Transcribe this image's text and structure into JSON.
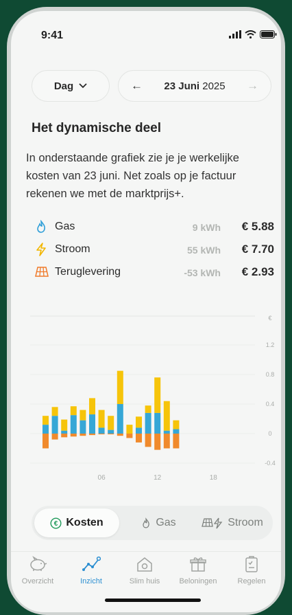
{
  "status": {
    "time": "9:41"
  },
  "period": {
    "selector_label": "Dag",
    "date_day": "23 Juni",
    "date_year": "2025"
  },
  "section": {
    "title": "Het dynamische deel",
    "intro": "In onderstaande grafiek zie je je werkelijke kosten van 23 juni. Net zoals op je factuur rekenen we met de marktprijs+."
  },
  "summary": [
    {
      "label": "Gas",
      "kwh": "9 kWh",
      "cost": "€ 5.88",
      "icon": "flame-icon",
      "color": "#2f9fd8"
    },
    {
      "label": "Stroom",
      "kwh": "55 kWh",
      "cost": "€ 7.70",
      "icon": "lightning-icon",
      "color": "#f2b600"
    },
    {
      "label": "Teruglevering",
      "kwh": "-53 kWh",
      "cost": "€ 2.93",
      "icon": "solar-panel-icon",
      "color": "#f07a2a"
    }
  ],
  "chart_data": {
    "type": "bar",
    "stacked": true,
    "unit_label": "€",
    "y_ticks": [
      "1.2",
      "0.8",
      "0.4",
      "0",
      "-0.4"
    ],
    "ylim": [
      -0.4,
      1.2
    ],
    "x_ticks": [
      "06",
      "12",
      "18"
    ],
    "x_tick_hours": [
      6,
      12,
      18
    ],
    "hours": [
      0,
      1,
      2,
      3,
      4,
      5,
      6,
      7,
      8,
      9,
      10,
      11,
      12,
      13,
      14,
      15,
      16,
      17,
      18,
      19,
      20,
      21,
      22,
      23
    ],
    "series": [
      {
        "name": "Gas",
        "color": "#36a7d6",
        "values": [
          0.12,
          0.24,
          0.04,
          0.25,
          0.18,
          0.26,
          0.08,
          0.05,
          0.4,
          0,
          0.08,
          0.28,
          0.28,
          0.04,
          0.06,
          0,
          0,
          0,
          0,
          0,
          0,
          0,
          0,
          0
        ]
      },
      {
        "name": "Stroom",
        "color": "#f6c40a",
        "values": [
          0.12,
          0.12,
          0.15,
          0.12,
          0.14,
          0.22,
          0.24,
          0.19,
          0.45,
          0.12,
          0.15,
          0.1,
          0.48,
          0.4,
          0.12,
          0,
          0,
          0,
          0,
          0,
          0,
          0,
          0,
          0
        ]
      },
      {
        "name": "Teruglevering",
        "color": "#f08a2c",
        "values": [
          -0.2,
          -0.08,
          -0.05,
          -0.04,
          -0.03,
          -0.02,
          -0.01,
          -0.01,
          -0.03,
          -0.06,
          -0.12,
          -0.18,
          -0.22,
          -0.2,
          -0.2,
          0,
          0,
          0,
          0,
          0,
          0,
          0,
          0,
          0
        ]
      }
    ]
  },
  "tabs_toggle": [
    {
      "label": "Kosten",
      "icon": "euro-icon",
      "active": true
    },
    {
      "label": "Gas",
      "icon": "flame-icon",
      "active": false
    },
    {
      "label": "Stroom",
      "icon": "solar-lightning-icon",
      "active": false
    }
  ],
  "nav": [
    {
      "label": "Overzicht",
      "icon": "piggy-bank-icon",
      "active": false
    },
    {
      "label": "Inzicht",
      "icon": "insight-graph-icon",
      "active": true
    },
    {
      "label": "Slim huis",
      "icon": "smart-home-icon",
      "active": false
    },
    {
      "label": "Beloningen",
      "icon": "gift-icon",
      "active": false
    },
    {
      "label": "Regelen",
      "icon": "clipboard-icon",
      "active": false
    }
  ],
  "colors": {
    "accent": "#2c8fd1",
    "background": "#0f4a33"
  }
}
